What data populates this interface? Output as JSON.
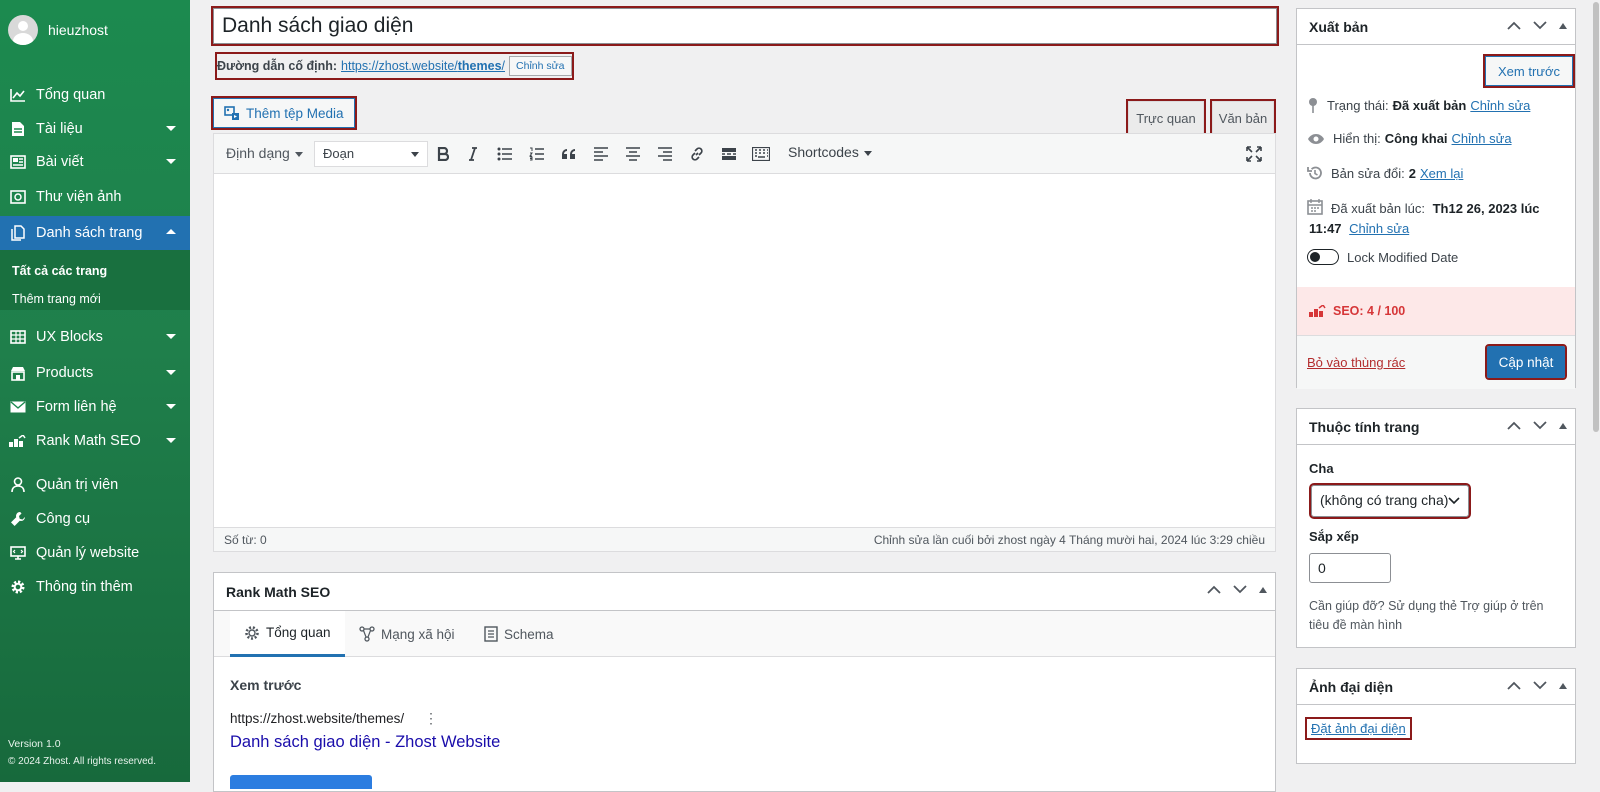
{
  "sidebar": {
    "username": "hieuzhost",
    "items": [
      {
        "label": "Tổng quan",
        "icon": "chart-line-icon",
        "arrow": false
      },
      {
        "label": "Tài liệu",
        "icon": "document-icon",
        "arrow": true
      },
      {
        "label": "Bài viết",
        "icon": "newspaper-icon",
        "arrow": true
      },
      {
        "label": "Thư viện ảnh",
        "icon": "camera-icon",
        "arrow": false
      },
      {
        "label": "Danh sách trang",
        "icon": "pages-icon",
        "arrow": true,
        "active": true
      },
      {
        "label": "UX Blocks",
        "icon": "grid-icon",
        "arrow": true
      },
      {
        "label": "Products",
        "icon": "store-icon",
        "arrow": true
      },
      {
        "label": "Form liên hệ",
        "icon": "mail-icon",
        "arrow": true
      },
      {
        "label": "Rank Math SEO",
        "icon": "rank-math-icon",
        "arrow": true
      },
      {
        "label": "Quản trị viên",
        "icon": "user-icon",
        "arrow": false
      },
      {
        "label": "Công cụ",
        "icon": "wrench-icon",
        "arrow": false
      },
      {
        "label": "Quản lý website",
        "icon": "monitor-icon",
        "arrow": false
      },
      {
        "label": "Thông tin thêm",
        "icon": "gear-icon",
        "arrow": false
      }
    ],
    "submenu": {
      "current": "Tất cả các trang",
      "other": "Thêm trang mới"
    },
    "version": "Version 1.0",
    "copyright": "© 2024 Zhost. All rights reserved."
  },
  "editor": {
    "title": "Danh sách giao diện",
    "permalink_label": "Đường dẫn cố định:",
    "permalink_url": "https://zhost.website/",
    "permalink_slug": "themes",
    "permalink_end": "/",
    "permalink_edit": "Chỉnh sửa",
    "add_media": "Thêm tệp Media",
    "tab_visual": "Trực quan",
    "tab_text": "Văn bản",
    "format_menu": "Định dạng",
    "block_select": "Đoạn",
    "shortcodes": "Shortcodes",
    "word_count": "Số từ: 0",
    "last_edited": "Chỉnh sửa lần cuối bởi zhost ngày 4 Tháng mười hai, 2024 lúc 3:29 chiều"
  },
  "rankmath": {
    "title": "Rank Math SEO",
    "tabs": [
      "Tổng quan",
      "Mạng xã hội",
      "Schema"
    ],
    "preview_title": "Xem trước",
    "preview_url": "https://zhost.website/themes/",
    "preview_page_title": "Danh sách giao diện - Zhost Website"
  },
  "publish": {
    "title": "Xuất bản",
    "preview_button": "Xem trước",
    "status_label": "Trạng thái:",
    "status_value": "Đã xuất bản",
    "visibility_label": "Hiển thị:",
    "visibility_value": "Công khai",
    "revisions_label": "Bản sửa đổi:",
    "revisions_value": "2",
    "revisions_link": "Xem lại",
    "published_label": "Đã xuất bản lúc:",
    "published_value_1": "Th12 26, 2023 lúc",
    "published_value_2": "11:47",
    "edit_link": "Chỉnh sửa",
    "lock_label": "Lock Modified Date",
    "seo_score": "SEO: 4 / 100",
    "trash_link": "Bỏ vào thùng rác",
    "update_button": "Cập nhật"
  },
  "attributes": {
    "title": "Thuộc tính trang",
    "parent_label": "Cha",
    "parent_value": "(không có trang cha)",
    "order_label": "Sắp xếp",
    "order_value": "0",
    "help_text": "Cần giúp đỡ? Sử dụng thẻ Trợ giúp ở trên tiêu đề màn hình"
  },
  "featured": {
    "title": "Ảnh đại diện",
    "link": "Đặt ảnh đại diện"
  },
  "colors": {
    "sidebar": "#1c8a4f",
    "accent": "#2271b1",
    "highlight_outline": "#8b1a1a",
    "seo_bad": "#d63638"
  }
}
